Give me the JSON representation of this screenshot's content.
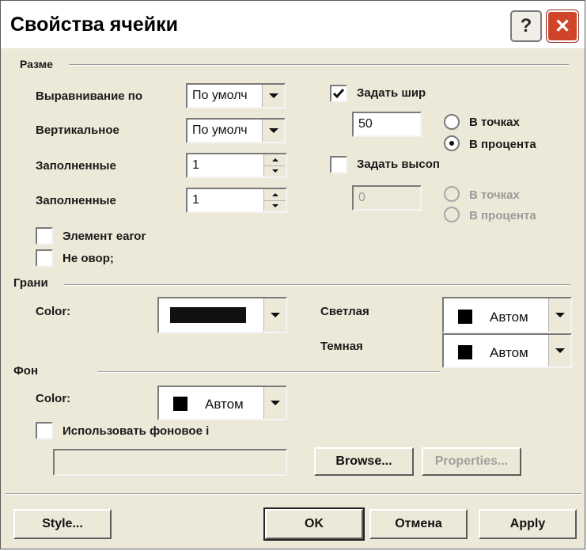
{
  "window": {
    "title": "Свойства ячейки",
    "help_glyph": "?",
    "close_glyph": "✕"
  },
  "layout_group": {
    "label": "Размe",
    "alignment": {
      "label": "Выравнивание по",
      "value": "По умолч"
    },
    "vertical": {
      "label": "Вертикальное",
      "value": "По умолч"
    },
    "filled_1": {
      "label": "Заполненные",
      "value": "1"
    },
    "filled_2": {
      "label": "Заполненные",
      "value": "1"
    },
    "element_checkbox": {
      "label": "Элемент earor",
      "checked": false
    },
    "no_wrap_checkbox": {
      "label": "Не овор;",
      "checked": false
    },
    "set_width": {
      "label": "Задать шир",
      "checked": true,
      "value": "50"
    },
    "width_units": {
      "points": "В точках",
      "percent": "В процента",
      "selected": "percent"
    },
    "set_height": {
      "label": "Задать высоп",
      "checked": false,
      "value": "0"
    },
    "height_units": {
      "points": "В точках",
      "percent": "В процента"
    }
  },
  "borders_group": {
    "label": "Грани",
    "color_label": "Color:",
    "color_value": "#000000",
    "light_label": "Светлая",
    "light_value": "Автом",
    "dark_label": "Темная",
    "dark_value": "Автом"
  },
  "background_group": {
    "label": "Фон",
    "color_label": "Color:",
    "color_value": "Автом",
    "use_image_checkbox": {
      "label": "Использовать фоновое i",
      "checked": false
    },
    "image_path": "",
    "browse_button": "Browse...",
    "properties_button": "Properties..."
  },
  "footer": {
    "style_button": "Style...",
    "ok_button": "OK",
    "cancel_button": "Отмена",
    "apply_button": "Apply"
  }
}
